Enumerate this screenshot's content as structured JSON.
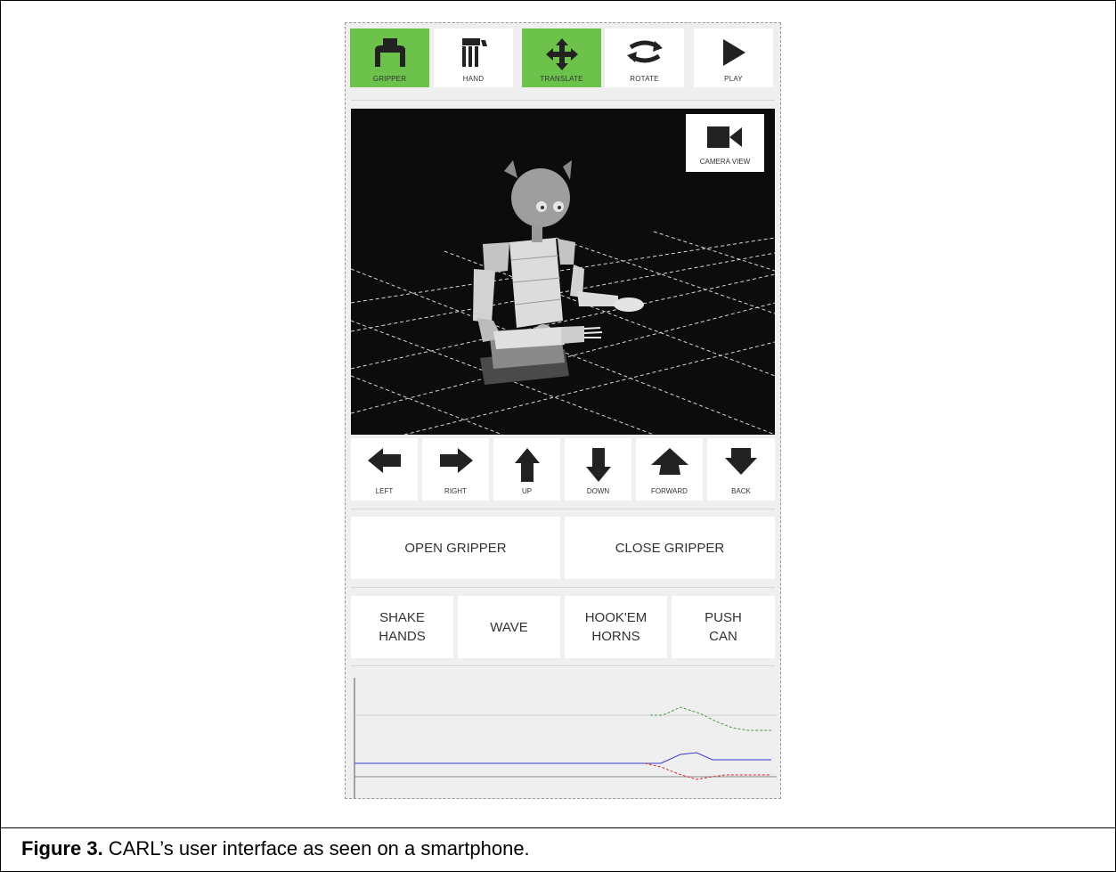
{
  "toolbar": {
    "gripper_label": "GRIPPER",
    "hand_label": "HAND",
    "translate_label": "TRANSLATE",
    "rotate_label": "ROTATE",
    "play_label": "PLAY"
  },
  "viewport": {
    "camera_view_label": "CAMERA VIEW"
  },
  "directions": {
    "left": "LEFT",
    "right": "RIGHT",
    "up": "UP",
    "down": "DOWN",
    "forward": "FORWARD",
    "back": "BACK"
  },
  "gripper_actions": {
    "open": "OPEN GRIPPER",
    "close": "CLOSE GRIPPER"
  },
  "gestures": {
    "shake_hands": "SHAKE HANDS",
    "wave": "WAVE",
    "hook_em_horns": "HOOK'EM HORNS",
    "push_can": "PUSH CAN"
  },
  "caption": {
    "label": "Figure 3.",
    "text": " CARL’s user interface as seen on a smartphone."
  },
  "colors": {
    "active": "#6cc24a",
    "series_green": "#4a9a4a",
    "series_blue": "#3a3ad0",
    "series_red": "#d03030"
  }
}
